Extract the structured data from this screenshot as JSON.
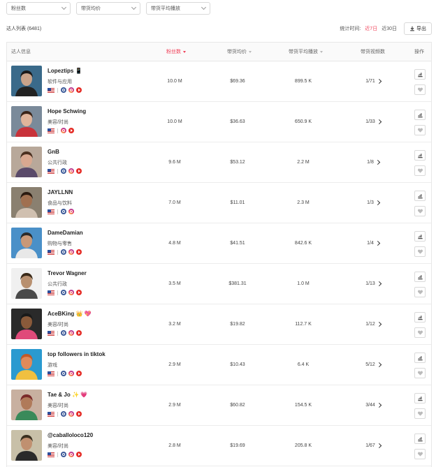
{
  "filters": [
    {
      "label": "粉丝数"
    },
    {
      "label": "带货均价"
    },
    {
      "label": "带货平均播放"
    }
  ],
  "list": {
    "title": "达人列表 (6481)",
    "time_label": "统计时间:",
    "ranges": [
      "近7日",
      "近30日"
    ],
    "active_range": "近7日",
    "export_label": "导出"
  },
  "table": {
    "headers": {
      "info": "达人信息",
      "followers": "粉丝数",
      "avg_price": "带货均价",
      "avg_views": "带货平均播放",
      "video_ratio": "带货视频数",
      "action": "操作"
    },
    "rows": [
      {
        "name": "Lopeztips 📱",
        "category": "软件与应用",
        "followers": "10.0 M",
        "avg_price": "$69.36",
        "avg_views": "899.5 K",
        "videos": "1/71",
        "socials": [
          "fb",
          "ig",
          "yt"
        ],
        "avatar": {
          "bg": "#3a6a8a",
          "skin": "#c9a38a",
          "hair": "#1a1a1a",
          "shirt": "#222"
        }
      },
      {
        "name": "Hope Schwing",
        "category": "美容/时尚",
        "followers": "10.0 M",
        "avg_price": "$36.63",
        "avg_views": "650.9 K",
        "videos": "1/33",
        "socials": [
          "ig",
          "yt"
        ],
        "avatar": {
          "bg": "#7a8a9a",
          "skin": "#e0b49a",
          "hair": "#3a2418",
          "shirt": "#c8323a"
        }
      },
      {
        "name": "GnB",
        "category": "公共行政",
        "followers": "9.6 M",
        "avg_price": "$53.12",
        "avg_views": "2.2 M",
        "videos": "1/8",
        "socials": [
          "fb",
          "ig",
          "yt"
        ],
        "avatar": {
          "bg": "#b8a89a",
          "skin": "#d8a890",
          "hair": "#4a3020",
          "shirt": "#5a4a6a"
        }
      },
      {
        "name": "JAYLLNN",
        "category": "食品与饮料",
        "followers": "7.0 M",
        "avg_price": "$11.01",
        "avg_views": "2.3 M",
        "videos": "1/3",
        "socials": [
          "fb",
          "ig"
        ],
        "avatar": {
          "bg": "#8a8070",
          "skin": "#a07050",
          "hair": "#2a1a10",
          "shirt": "#d0c0b0"
        }
      },
      {
        "name": "DameDamian",
        "category": "购物与零售",
        "followers": "4.8 M",
        "avg_price": "$41.51",
        "avg_views": "842.6 K",
        "videos": "1/4",
        "socials": [
          "fb",
          "ig",
          "yt"
        ],
        "avatar": {
          "bg": "#4a90c8",
          "skin": "#c89878",
          "hair": "#2a2a2a",
          "shirt": "#e8e8e8"
        }
      },
      {
        "name": "Trevor Wagner",
        "category": "公共行政",
        "followers": "3.5 M",
        "avg_price": "$381.31",
        "avg_views": "1.0 M",
        "videos": "1/13",
        "socials": [
          "fb",
          "ig",
          "yt"
        ],
        "avatar": {
          "bg": "#f0f0f0",
          "skin": "#b89070",
          "hair": "#3a2a1a",
          "shirt": "#4a4a4a"
        }
      },
      {
        "name": "AceBKing 👑 💖",
        "category": "美容/时尚",
        "followers": "3.2 M",
        "avg_price": "$19.82",
        "avg_views": "112.7 K",
        "videos": "1/12",
        "socials": [
          "fb",
          "ig",
          "yt"
        ],
        "avatar": {
          "bg": "#2a2a2a",
          "skin": "#8a5a3a",
          "hair": "#1a1a1a",
          "shirt": "#e04a7a"
        }
      },
      {
        "name": "top followers in tiktok",
        "category": "游戏",
        "followers": "2.9 M",
        "avg_price": "$10.43",
        "avg_views": "6.4 K",
        "videos": "5/12",
        "socials": [
          "fb",
          "ig",
          "yt"
        ],
        "avatar": {
          "bg": "#2a9ad0",
          "skin": "#e08a5a",
          "hair": "#c05a2a",
          "shirt": "#f0c040"
        }
      },
      {
        "name": "Tae & Jo ✨ 💗",
        "category": "美容/时尚",
        "followers": "2.9 M",
        "avg_price": "$60.82",
        "avg_views": "154.5 K",
        "videos": "3/44",
        "socials": [
          "fb",
          "ig",
          "yt"
        ],
        "avatar": {
          "bg": "#c8b0a0",
          "skin": "#b07a5a",
          "hair": "#7a2a2a",
          "shirt": "#3a8a5a"
        }
      },
      {
        "name": "@caballoloco120",
        "category": "美容/时尚",
        "followers": "2.8 M",
        "avg_price": "$19.69",
        "avg_views": "205.8 K",
        "videos": "1/67",
        "socials": [
          "fb",
          "ig",
          "yt"
        ],
        "avatar": {
          "bg": "#c8c0a8",
          "skin": "#c09070",
          "hair": "#3a3020",
          "shirt": "#2a2a2a"
        }
      }
    ]
  },
  "colors": {
    "accent": "#f0425a",
    "border": "#e8e8e8"
  }
}
